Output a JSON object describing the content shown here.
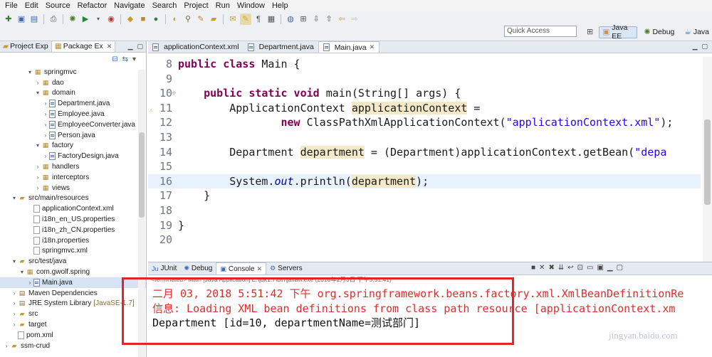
{
  "menu": [
    "File",
    "Edit",
    "Source",
    "Refactor",
    "Navigate",
    "Search",
    "Project",
    "Run",
    "Window",
    "Help"
  ],
  "toolbar": {
    "quick_access_placeholder": "Quick Access",
    "perspectives": [
      "Java EE",
      "Debug",
      "Java"
    ]
  },
  "left": {
    "tabs": [
      "Project Exp",
      "Package Ex"
    ],
    "tree": [
      {
        "label": "springmvc",
        "type": "pkg",
        "indent": 3,
        "arrow": "v"
      },
      {
        "label": "dao",
        "type": "pkg",
        "indent": 4,
        "arrow": ">"
      },
      {
        "label": "domain",
        "type": "pkg",
        "indent": 4,
        "arrow": "v"
      },
      {
        "label": "Department.java",
        "type": "java",
        "indent": 5,
        "arrow": ">"
      },
      {
        "label": "Employee.java",
        "type": "java",
        "indent": 5,
        "arrow": ">"
      },
      {
        "label": "EmployeeConverter.java",
        "type": "java",
        "indent": 5,
        "arrow": ">"
      },
      {
        "label": "Person.java",
        "type": "java",
        "indent": 5,
        "arrow": ">"
      },
      {
        "label": "factory",
        "type": "pkg",
        "indent": 4,
        "arrow": "v"
      },
      {
        "label": "FactoryDesign.java",
        "type": "java",
        "indent": 5,
        "arrow": ">"
      },
      {
        "label": "handlers",
        "type": "pkg",
        "indent": 4,
        "arrow": ">"
      },
      {
        "label": "interceptors",
        "type": "pkg",
        "indent": 4,
        "arrow": ">"
      },
      {
        "label": "views",
        "type": "pkg",
        "indent": 4,
        "arrow": ">"
      },
      {
        "label": "src/main/resources",
        "type": "folder",
        "indent": 1,
        "arrow": "v"
      },
      {
        "label": "applicationContext.xml",
        "type": "file",
        "indent": 3,
        "arrow": ""
      },
      {
        "label": "i18n_en_US.properties",
        "type": "file",
        "indent": 3,
        "arrow": ""
      },
      {
        "label": "i18n_zh_CN.properties",
        "type": "file",
        "indent": 3,
        "arrow": ""
      },
      {
        "label": "i18n.properties",
        "type": "file",
        "indent": 3,
        "arrow": ""
      },
      {
        "label": "springmvc.xml",
        "type": "file",
        "indent": 3,
        "arrow": ""
      },
      {
        "label": "src/test/java",
        "type": "folder",
        "indent": 1,
        "arrow": "v"
      },
      {
        "label": "com.gwolf.spring",
        "type": "pkg",
        "indent": 2,
        "arrow": "v"
      },
      {
        "label": "Main.java",
        "type": "java",
        "indent": 3,
        "arrow": ">",
        "selected": true
      },
      {
        "label": "Maven Dependencies",
        "type": "lib",
        "indent": 1,
        "arrow": ">"
      },
      {
        "label": "JRE System Library",
        "suffix": "[JavaSE-1.7]",
        "type": "lib",
        "indent": 1,
        "arrow": ">"
      },
      {
        "label": "src",
        "type": "folder",
        "indent": 1,
        "arrow": ">"
      },
      {
        "label": "target",
        "type": "folder",
        "indent": 1,
        "arrow": ">"
      },
      {
        "label": "pom.xml",
        "type": "file",
        "indent": 1,
        "arrow": ""
      },
      {
        "label": "ssm-crud",
        "type": "folder",
        "indent": 0,
        "arrow": ">"
      }
    ]
  },
  "editor": {
    "tabs": [
      "applicationContext.xml",
      "Department.java",
      "Main.java"
    ],
    "active_tab": 2,
    "lines": [
      {
        "n": "8",
        "parts": [
          [
            "kw",
            "public class "
          ],
          [
            "",
            "Main {"
          ]
        ]
      },
      {
        "n": "9",
        "parts": []
      },
      {
        "n": "10",
        "parts": [
          [
            "",
            "    "
          ],
          [
            "kw",
            "public static void "
          ],
          [
            "",
            "main(String[] args) {"
          ]
        ]
      },
      {
        "n": "11",
        "parts": [
          [
            "",
            "        ApplicationContext "
          ],
          [
            "occ",
            "applicationContext"
          ],
          [
            "",
            " ="
          ]
        ]
      },
      {
        "n": "12",
        "parts": [
          [
            "",
            "                "
          ],
          [
            "kw",
            "new "
          ],
          [
            "",
            "ClassPathXmlApplicationContext("
          ],
          [
            "str",
            "\"applicationContext.xml\""
          ],
          [
            "",
            ");"
          ]
        ]
      },
      {
        "n": "13",
        "parts": []
      },
      {
        "n": "14",
        "parts": [
          [
            "",
            "        Department "
          ],
          [
            "occ",
            "department"
          ],
          [
            "",
            " = (Department)applicationContext.getBean("
          ],
          [
            "str",
            "\"depa"
          ]
        ]
      },
      {
        "n": "15",
        "parts": []
      },
      {
        "n": "16",
        "parts": [
          [
            "",
            "        System."
          ],
          [
            "fld",
            "out"
          ],
          [
            "",
            ".println("
          ],
          [
            "occ",
            "department"
          ],
          [
            "",
            ");"
          ]
        ],
        "highlight": true
      },
      {
        "n": "17",
        "parts": [
          [
            "",
            "    }"
          ]
        ]
      },
      {
        "n": "18",
        "parts": []
      },
      {
        "n": "19",
        "parts": [
          [
            "",
            "}"
          ]
        ]
      },
      {
        "n": "20",
        "parts": []
      }
    ]
  },
  "console": {
    "tabs": [
      "JUnit",
      "Debug",
      "Console",
      "Servers"
    ],
    "active_tab": 2,
    "terminated": "<terminated> Main [Java Application] E:\\jdk1.7\\bin\\javaw.exe (2018年2月3日 下午5:51:41)",
    "lines": [
      {
        "text": "二月 03, 2018 5:51:42 下午 org.springframework.beans.factory.xml.XmlBeanDefinitionRe",
        "kind": "err"
      },
      {
        "text": "信息: Loading XML bean definitions from class path resource [applicationContext.xm",
        "kind": "err"
      },
      {
        "text": "Department [id=10, departmentName=测试部门]",
        "kind": "norm"
      }
    ]
  },
  "watermark": "jingyan.baidu.com"
}
